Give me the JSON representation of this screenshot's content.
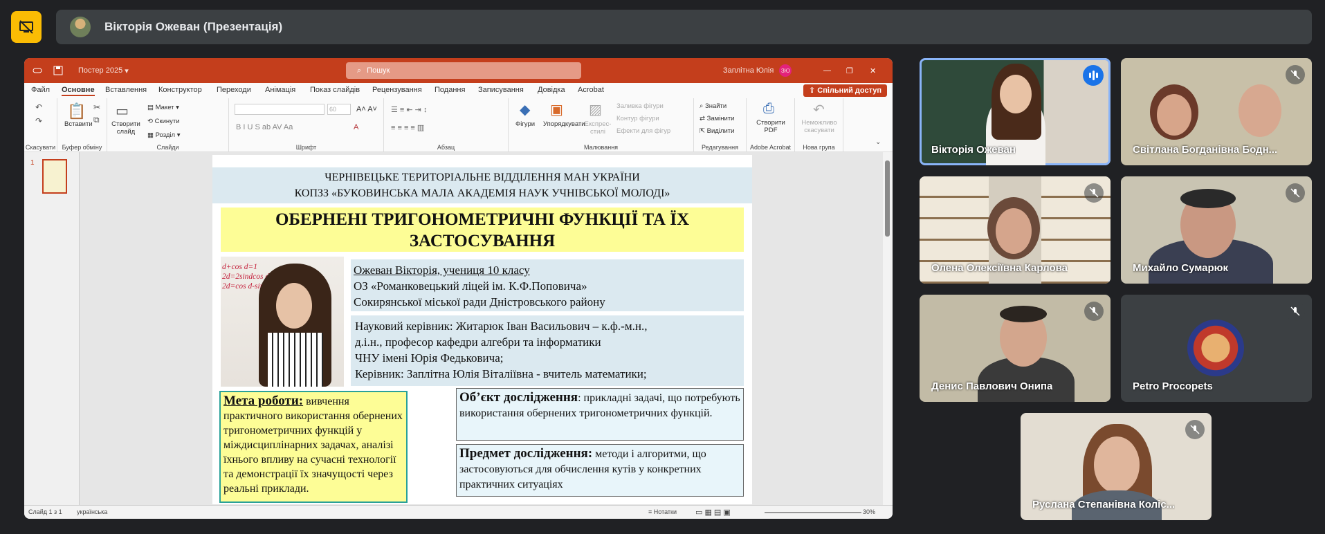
{
  "meet": {
    "presenter_title": "Вікторія Ожеван (Презентація)",
    "participants": [
      {
        "name": "Вікторія Ожеван",
        "speaking": true
      },
      {
        "name": "Світлана Богданівна Бодн...",
        "muted": true
      },
      {
        "name": "Олена Олексіївна Карлова",
        "muted": true
      },
      {
        "name": "Михайло Сумарюк",
        "muted": true
      },
      {
        "name": "Денис Павлович Онипа",
        "muted": true
      },
      {
        "name": "Petro Procopets",
        "muted": true
      },
      {
        "name": "Руслана Степанівна Коліс...",
        "muted": true
      }
    ]
  },
  "ppt": {
    "file_name": "Постер 2025",
    "search_placeholder": "Пошук",
    "user_name": "Заплітна Юлія",
    "user_initials": "ЗЮ",
    "share_label": "Спільний доступ",
    "tabs": [
      "Файл",
      "Основне",
      "Вставлення",
      "Конструктор",
      "Переходи",
      "Анімація",
      "Показ слайдів",
      "Рецензування",
      "Подання",
      "Записування",
      "Довідка",
      "Acrobat"
    ],
    "ribbon": {
      "undo_group": "Скасувати",
      "clipboard": {
        "paste": "Вставити",
        "label": "Буфер обміну"
      },
      "slides": {
        "new": "Створити слайд",
        "layout": "Макет",
        "reset": "Скинути",
        "section": "Розділ",
        "label": "Слайди"
      },
      "font": {
        "size": "60",
        "label": "Шрифт"
      },
      "paragraph": {
        "label": "Абзац"
      },
      "drawing": {
        "shapes": "Фігури",
        "arrange": "Упорядкувати",
        "quick_styles": "Експрес-стилі",
        "fill": "Заливка фігури",
        "outline": "Контур фігури",
        "effects": "Ефекти для фігур",
        "label": "Малювання"
      },
      "editing": {
        "find": "Знайти",
        "replace": "Замінити",
        "select": "Виділити",
        "label": "Редагування"
      },
      "acrobat": {
        "create_pdf": "Створити PDF",
        "label": "Adobe Acrobat"
      },
      "newgroup": {
        "undo_not": "Неможливо скасувати",
        "label": "Нова група"
      }
    },
    "slide_number": "1",
    "status": {
      "slide": "Слайд 1 з 1",
      "language": "українська",
      "notes": "Нотатки",
      "zoom": "30%"
    }
  },
  "slide": {
    "header_line1": "ЧЕРНІВЕЦЬКЕ ТЕРИТОРІАЛЬНЕ ВІДДІЛЕННЯ МАН УКРАЇНИ",
    "header_line2": "КОПЗЗ «БУКОВИНСЬКА МАЛА АКАДЕМІЯ НАУК УЧНІВСЬКОЇ МОЛОДІ»",
    "title_line1": "ОБЕРНЕНІ ТРИГОНОМЕТРИЧНІ ФУНКЦІЇ ТА ЇХ",
    "title_line2": "ЗАСТОСУВАННЯ",
    "photo_formulas": [
      "d+cos d=1",
      "2d=2sindcos d",
      "2d=cos d-sin"
    ],
    "author": [
      "Ожеван Вікторія, учениця 10 класу",
      "ОЗ «Романковецький ліцей ім. К.Ф.Поповича»",
      "Сокирянської міської ради Дністровського району"
    ],
    "supervisor": [
      "Науковий керівник: Житарюк Іван Васильович – к.ф.-м.н.,",
      "д.і.н., професор кафедри алгебри  та інформатики",
      "ЧНУ імені Юрія Федьковича;",
      "Керівник: Заплітна Юлія Віталіївна - вчитель математики;"
    ],
    "goal_title": "Мета роботи:",
    "goal_text": " вивчення практичного використання обернених тригонометричних функцій у міждисциплінарних задачах, аналізі їхнього впливу на сучасні технології та демонстрації їх значущості через реальні приклади.",
    "object_title": "Об’єкт дослідження",
    "object_text": ": прикладні задачі, що потребують використання обернених тригонометричних функцій.",
    "subject_title": "Предмет дослідження:",
    "subject_text": " методи і алгоритми, що застосовуються для обчислення кутів у конкретних практичних ситуаціях"
  }
}
